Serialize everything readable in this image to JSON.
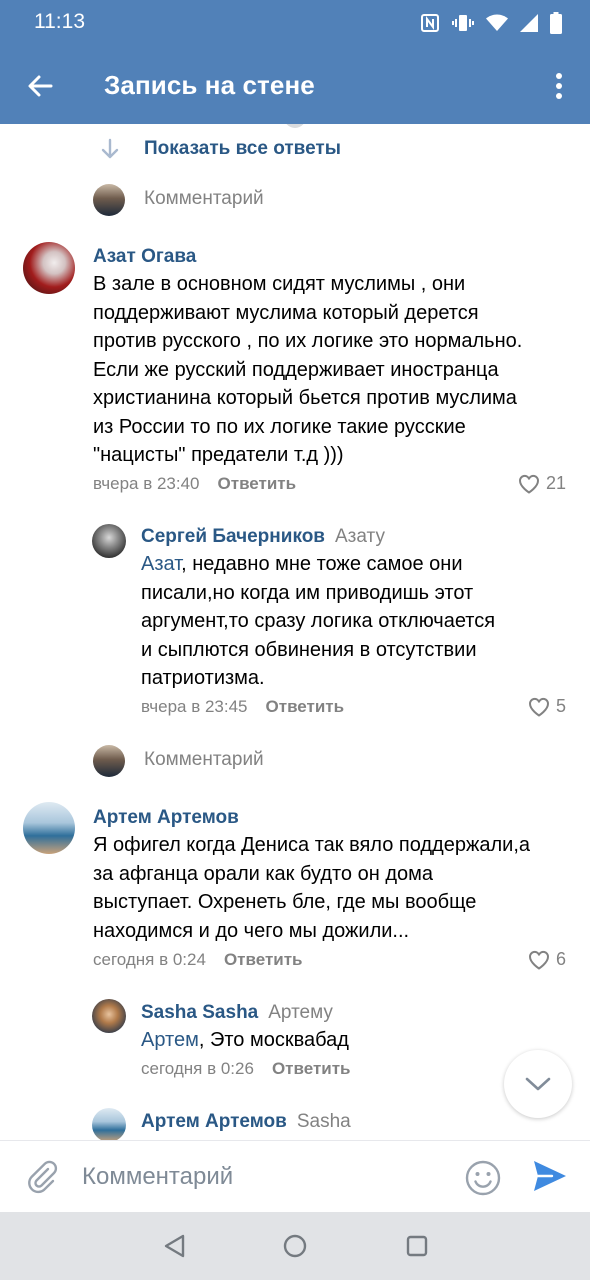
{
  "status_bar": {
    "time": "11:13"
  },
  "header": {
    "title": "Запись на стене"
  },
  "thread": {
    "show_all_replies": "Показать все ответы",
    "comment_prompt_1": "Комментарий",
    "comment_prompt_2": "Комментарий"
  },
  "comments": [
    {
      "author": "Азат Огава",
      "lines": [
        "В зале в основном сидят муслимы , они",
        "поддерживают муслима который дерется",
        "против русского , по их логике это нормально.",
        "Если же русский поддерживает иностранца",
        "христианина который бьется против муслима",
        "из России то по их логике такие русские",
        "\"нацисты\" предатели т.д )))"
      ],
      "time": "вчера в 23:40",
      "reply": "Ответить",
      "likes": "21"
    },
    {
      "author": "Сергей Бачерников",
      "reply_to": "Азату",
      "mention": "Азат",
      "first_line_rest": ", недавно мне тоже самое они",
      "lines": [
        "писали,но когда им приводишь этот",
        "аргумент,то сразу логика отключается",
        "и сыплются обвинения в отсутствии",
        "патриотизма."
      ],
      "time": "вчера в 23:45",
      "reply": "Ответить",
      "likes": "5"
    },
    {
      "author": "Артем Артемов",
      "lines": [
        "Я офигел когда Дениса так вяло поддержали,а",
        "за афганца орали как будто он дома",
        "выступает. Охренеть бле, где мы вообще",
        "находимся и до чего мы дожили..."
      ],
      "time": "сегодня в 0:24",
      "reply": "Ответить",
      "likes": "6"
    },
    {
      "author": "Sasha Sasha",
      "reply_to": "Артему",
      "mention": "Артем",
      "first_line_rest": ", Это москвабад",
      "time": "сегодня в 0:26",
      "reply": "Ответить"
    },
    {
      "author": "Артем Артемов",
      "reply_to": "Sasha"
    }
  ],
  "composer": {
    "placeholder": "Комментарий"
  },
  "colors": {
    "header": "#5181b8",
    "link": "#2a5885",
    "secondary": "#828282",
    "send": "#3f8ae0"
  },
  "icons": {
    "back": "arrow-back-icon",
    "menu": "more-vertical-icon",
    "show_all": "arrow-down-icon",
    "like": "heart-icon",
    "scroll": "chevron-down-icon",
    "attach": "paperclip-icon",
    "emoji": "smile-icon",
    "send": "send-icon"
  }
}
